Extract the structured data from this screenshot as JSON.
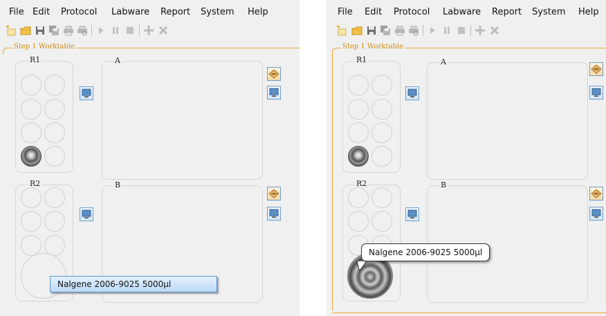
{
  "menu": [
    "File",
    "Edit",
    "Protocol",
    "Labware",
    "Report",
    "System",
    "Help"
  ],
  "toolbar_icons": [
    "new-protocol-icon",
    "open-folder-icon",
    "save-icon",
    "save-as-icon",
    "print-icon",
    "print-preview-icon",
    "run-icon",
    "pause-icon",
    "stop-icon",
    "add-icon",
    "remove-icon"
  ],
  "worktable": {
    "step_label": "Step 1 Worktable",
    "racks": [
      {
        "label": "R1"
      },
      {
        "label": "R2"
      }
    ],
    "plates": [
      {
        "label": "A"
      },
      {
        "label": "B"
      }
    ]
  },
  "tooltip_text": "Nalgene 2006-9025 5000µl",
  "colors": {
    "accent_line": "#f0a830",
    "tooltip_bg": "#cfe4fa",
    "tooltip_border": "#5a8ec8",
    "background": "#f0f0f0"
  }
}
